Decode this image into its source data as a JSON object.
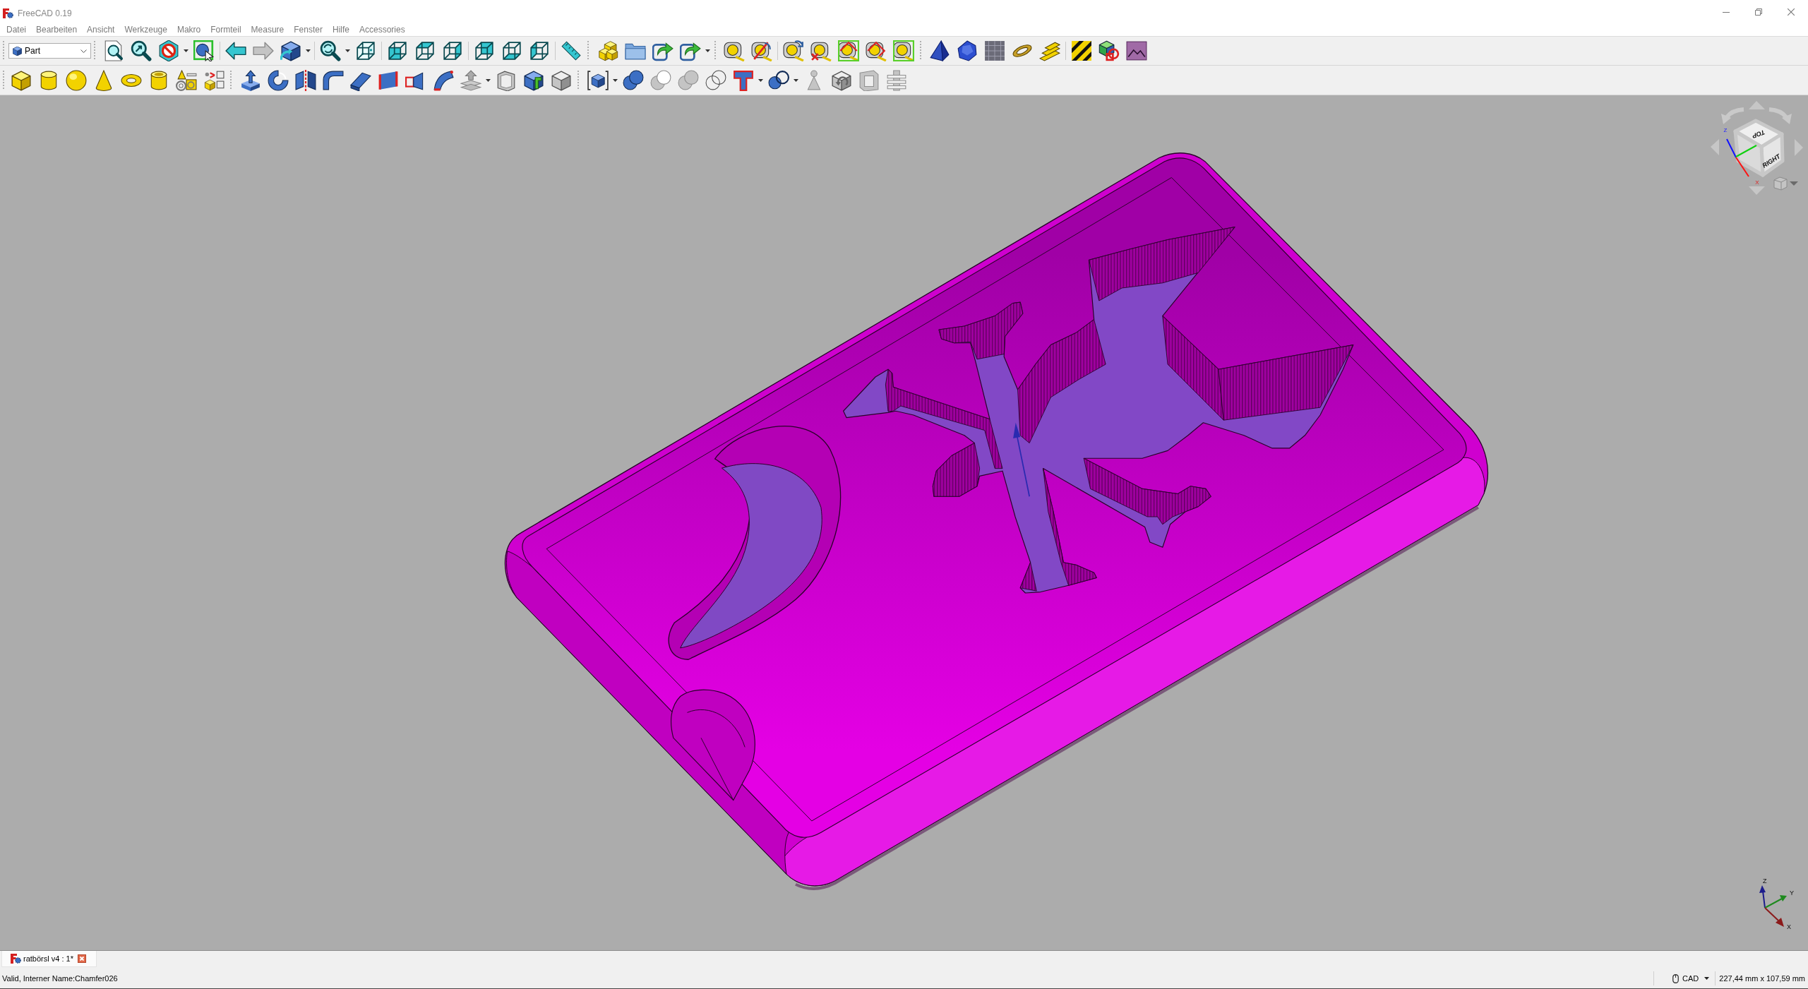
{
  "window": {
    "title": "FreeCAD 0.19"
  },
  "menu": [
    "Datei",
    "Bearbeiten",
    "Ansicht",
    "Werkzeuge",
    "Makro",
    "Formteil",
    "Measure",
    "Fenster",
    "Hilfe",
    "Accessories"
  ],
  "workbench": {
    "value": "Part"
  },
  "viewport": {
    "nav_cube": {
      "faces": [
        "TOP",
        "RIGHT"
      ],
      "axes": [
        "Z",
        "X"
      ]
    },
    "axis_indicator": [
      "Z",
      "Y",
      "X"
    ]
  },
  "document_tabs": [
    {
      "label": "ratbörsl v4 : 1*",
      "selected": true
    }
  ],
  "status_bar": {
    "message": "Valid, Interner Name:Chamfer026",
    "navigation_style": "CAD",
    "dimensions": "227,44 mm x 107,59 mm"
  }
}
